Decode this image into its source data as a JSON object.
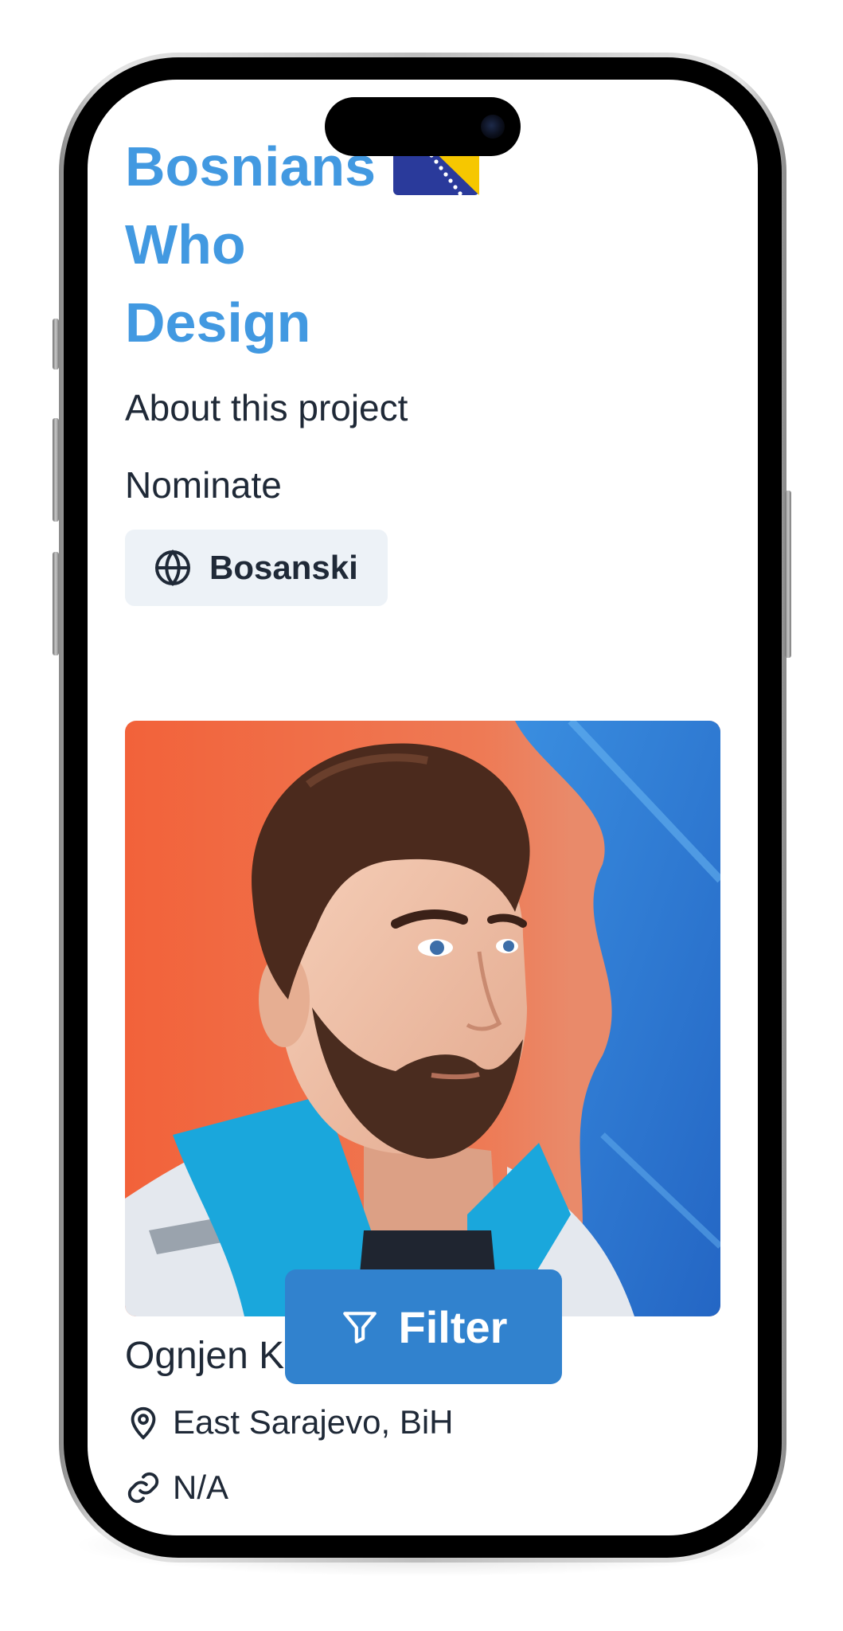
{
  "header": {
    "title_line1": "Bosnians",
    "title_line2": "Who",
    "title_line3": "Design",
    "flag_icon": "bosnia-flag-icon"
  },
  "nav": {
    "about_label": "About this project",
    "nominate_label": "Nominate"
  },
  "language_button": {
    "icon": "globe-icon",
    "label": "Bosanski"
  },
  "designer_card": {
    "image": "designer-portrait",
    "name": "Ognjen K",
    "location_icon": "map-pin-icon",
    "location": "East Sarajevo, BiH",
    "link_icon": "link-icon",
    "link": "N/A"
  },
  "filter_button": {
    "icon": "filter-icon",
    "label": "Filter"
  },
  "colors": {
    "accent": "#4299e1",
    "button_blue": "#3182ce",
    "text": "#1f2937",
    "chip_bg": "#edf2f7",
    "portrait_orange": "#f0643a",
    "portrait_blue": "#2f86dc"
  }
}
